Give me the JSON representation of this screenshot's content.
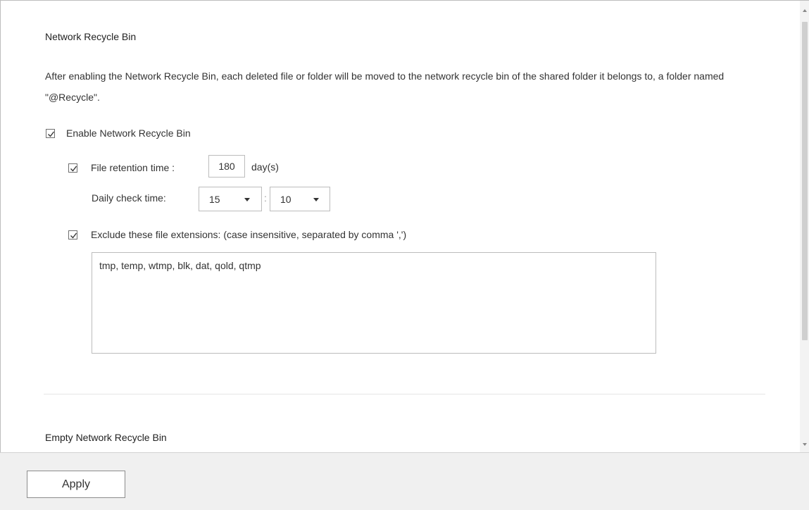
{
  "recycle_bin": {
    "title": "Network Recycle Bin",
    "description": "After enabling the Network Recycle Bin, each deleted file or folder will be moved to the network recycle bin of the shared folder it belongs to, a folder named \"@Recycle\".",
    "enable_label": "Enable Network Recycle Bin",
    "enable_checked": true,
    "retention_label": "File retention time :",
    "retention_checked": true,
    "retention_value": "180",
    "retention_unit": "day(s)",
    "daily_check_label": "Daily check time:",
    "check_hour": "15",
    "time_separator": ":",
    "check_minute": "10",
    "exclude_label": "Exclude these file extensions: (case insensitive, separated by comma ',')",
    "exclude_checked": true,
    "exclude_value": "tmp, temp, wtmp, blk, dat, qold, qtmp"
  },
  "empty_section": {
    "title": "Empty Network Recycle Bin"
  },
  "footer": {
    "apply_label": "Apply"
  },
  "icons": {
    "checkbox_check": "check-icon",
    "dropdown": "chevron-down-icon"
  }
}
